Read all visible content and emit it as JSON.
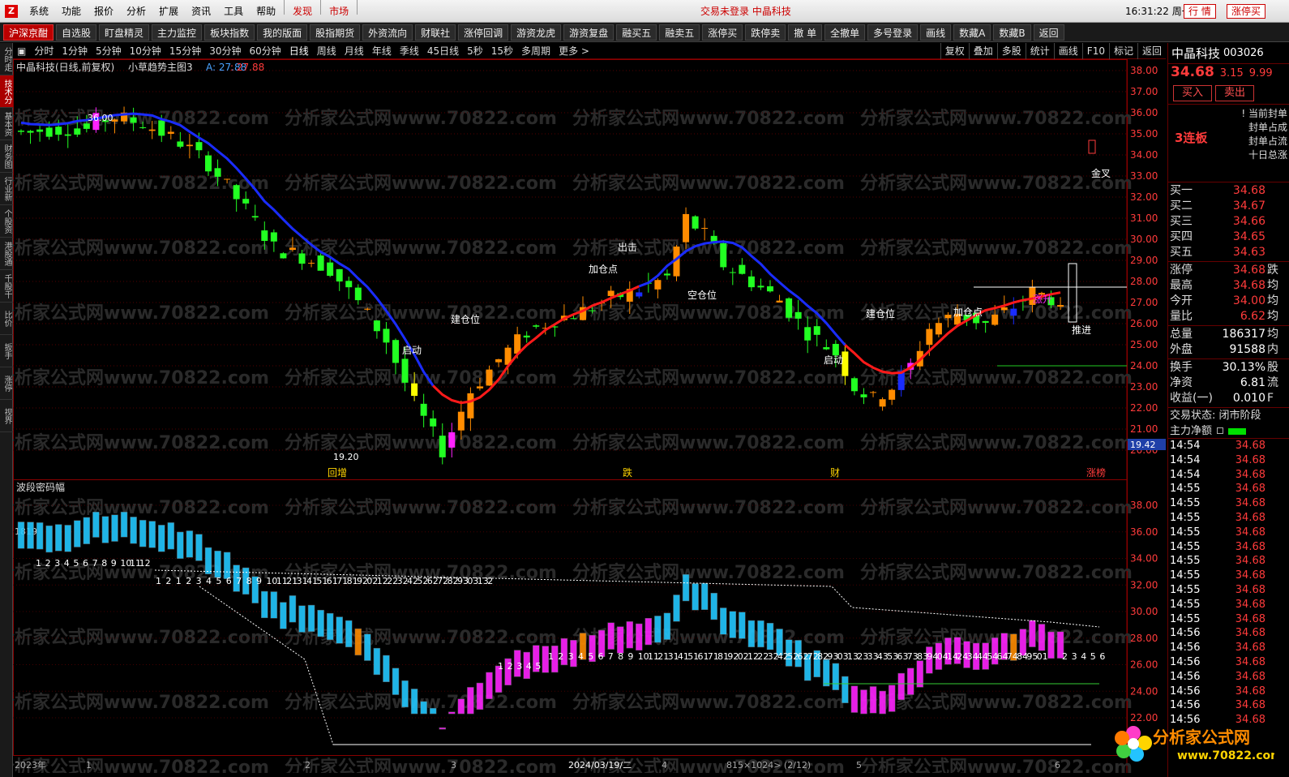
{
  "menu": {
    "items": [
      "系统",
      "功能",
      "报价",
      "分析",
      "扩展",
      "资讯",
      "工具",
      "帮助"
    ],
    "red_items": [
      "发现",
      "市场"
    ],
    "status_text": "交易未登录  中晶科技",
    "clock": "16:31:22 周一",
    "btn_quote": "行 情",
    "btn_limitup": "涨停买"
  },
  "toolbar": {
    "items": [
      "沪深京酣",
      "自选股",
      "盯盘精灵",
      "主力监控",
      "板块指数",
      "我的版面",
      "股指期货",
      "外资流向",
      "财联社",
      "涨停回调",
      "游资龙虎",
      "游资复盘",
      "融买五",
      "融卖五",
      "涨停买",
      "跌停卖",
      "撤 单",
      "全撤单",
      "多号登录",
      "画线",
      "数藏A",
      "数藏B",
      "返回"
    ]
  },
  "periods": {
    "left": [
      "分时",
      "1分钟",
      "5分钟",
      "10分钟",
      "15分钟",
      "30分钟",
      "60分钟",
      "日线",
      "周线",
      "月线",
      "年线",
      "季线",
      "45日线",
      "5秒",
      "15秒",
      "多周期",
      "更多 >"
    ],
    "right": [
      "复权",
      "叠加",
      "多股",
      "统计",
      "画线",
      "F10",
      "标记",
      "返回"
    ]
  },
  "left_tabs": [
    "分时走势",
    "技术分析",
    "基本资料",
    "财务图示",
    "行业新闻",
    "个股资讯",
    "港股通",
    "千股千评",
    "比价",
    "扳手",
    "涨停",
    "视界"
  ],
  "main_chart": {
    "title": "中晶科技(日线,前复权)",
    "indicator": "小草趋势主图3",
    "indicator_a_label": "A: 27.88",
    "indicator_b_label": ": 27.88",
    "y_ticks": [
      "38.00",
      "37.00",
      "36.00",
      "35.00",
      "34.00",
      "33.00",
      "32.00",
      "31.00",
      "30.00",
      "29.00",
      "28.00",
      "27.00",
      "26.00",
      "25.00",
      "24.00",
      "23.00",
      "22.00",
      "21.00",
      "20.00"
    ],
    "y_min": 20,
    "y_max": 38,
    "current_price_tag": "19.42",
    "high_label": "36.00",
    "low_label": "19.20",
    "labels": [
      "启动",
      "建仓位",
      "加仓点",
      "出击",
      "空仓位",
      "启动",
      "建仓位",
      "加仓点",
      "涨升",
      "推进",
      "金叉"
    ],
    "bottom_tags": [
      "回增",
      "跌",
      "财",
      "涨榜"
    ]
  },
  "sub_chart": {
    "title": "波段密码幅",
    "y_ticks": [
      "38.00",
      "36.00",
      "34.00",
      "32.00",
      "30.00",
      "28.00",
      "26.00",
      "24.00",
      "22.00"
    ],
    "left_label": "1819",
    "count_row1": [
      "1",
      "2",
      "3",
      "4",
      "5",
      "6",
      "7",
      "8",
      "9",
      "10",
      "11",
      "12"
    ],
    "count_row2": [
      "1",
      "2",
      "1",
      "2",
      "3",
      "4",
      "5",
      "6",
      "7",
      "8",
      "9",
      "10",
      "11",
      "21",
      "31",
      "41",
      "51",
      "61",
      "71",
      "81",
      "92",
      "02",
      "12",
      "22",
      "32",
      "42",
      "52",
      "62",
      "72",
      "82",
      "93",
      "03",
      "13",
      "2"
    ],
    "count_row3": [
      "1",
      "2",
      "3",
      "4",
      "5"
    ],
    "count_row4": [
      "1",
      "2",
      "3",
      "4",
      "5",
      "6",
      "7",
      "8",
      "9",
      "10",
      "11",
      "21",
      "31",
      "41",
      "51",
      "61",
      "71",
      "81",
      "92",
      "02",
      "12",
      "22",
      "32",
      "42",
      "52",
      "62",
      "72",
      "82",
      "93",
      "03",
      "13",
      "23",
      "33",
      "43",
      "53",
      "63",
      "73",
      "83",
      "94",
      "04",
      "14",
      "24",
      "34",
      "44",
      "54",
      "64",
      "74",
      "84",
      "95",
      "01"
    ],
    "count_row5": [
      "2",
      "3",
      "4",
      "5",
      "6"
    ]
  },
  "x_axis": {
    "labels": [
      "2023年",
      "1",
      "2",
      "3",
      "2024/03/19/二",
      "4",
      "815×1024> (2/12)",
      "5",
      "6"
    ]
  },
  "right_panel": {
    "name": "中晶科技",
    "code": "003026",
    "price": "34.68",
    "change": "3.15",
    "pct": "9.99",
    "buy": "买入",
    "sell": "卖出",
    "streak": "3连板",
    "seal_lines": [
      "! 当前封单",
      "封单占成",
      "封单占流",
      "十日总涨"
    ],
    "bids": [
      {
        "k": "买一",
        "v": "34.68"
      },
      {
        "k": "买二",
        "v": "34.67"
      },
      {
        "k": "买三",
        "v": "34.66"
      },
      {
        "k": "买四",
        "v": "34.65"
      },
      {
        "k": "买五",
        "v": "34.63"
      }
    ],
    "stats1": [
      {
        "k": "涨停",
        "v": "34.68",
        "x": "跌"
      },
      {
        "k": "最高",
        "v": "34.68",
        "x": "均"
      },
      {
        "k": "今开",
        "v": "34.00",
        "x": "均"
      },
      {
        "k": "量比",
        "v": "6.62",
        "x": "均"
      }
    ],
    "stats2": [
      {
        "k": "总量",
        "v": "186317",
        "x": "均"
      },
      {
        "k": "外盘",
        "v": "91588",
        "x": "内"
      }
    ],
    "stats3": [
      {
        "k": "换手",
        "v": "30.13%",
        "x": "股"
      },
      {
        "k": "净资",
        "v": "6.81",
        "x": "流"
      },
      {
        "k": "收益(一)",
        "v": "0.010",
        "x": "F"
      }
    ],
    "trade_status": "交易状态: 闭市阶段",
    "main_net": "主力净额",
    "ticks": [
      {
        "t": "14:54",
        "p": "34.68"
      },
      {
        "t": "14:54",
        "p": "34.68"
      },
      {
        "t": "14:54",
        "p": "34.68"
      },
      {
        "t": "14:55",
        "p": "34.68"
      },
      {
        "t": "14:55",
        "p": "34.68"
      },
      {
        "t": "14:55",
        "p": "34.68"
      },
      {
        "t": "14:55",
        "p": "34.68"
      },
      {
        "t": "14:55",
        "p": "34.68"
      },
      {
        "t": "14:55",
        "p": "34.68"
      },
      {
        "t": "14:55",
        "p": "34.68"
      },
      {
        "t": "14:55",
        "p": "34.68"
      },
      {
        "t": "14:55",
        "p": "34.68"
      },
      {
        "t": "14:55",
        "p": "34.68"
      },
      {
        "t": "14:56",
        "p": "34.68"
      },
      {
        "t": "14:56",
        "p": "34.68"
      },
      {
        "t": "14:56",
        "p": "34.68"
      },
      {
        "t": "14:56",
        "p": "34.68"
      },
      {
        "t": "14:56",
        "p": "34.68"
      },
      {
        "t": "14:56",
        "p": "34.68"
      },
      {
        "t": "14:56",
        "p": "34.68"
      }
    ]
  },
  "watermark": "分析家公式网www.70822.com",
  "logo_text": "分析家公式网",
  "logo_url": "www.70822.com",
  "colors": {
    "up": "#ff3b3b",
    "down": "#00e000",
    "ma_blue": "#1a2cff",
    "ma_red": "#ff1a1a",
    "cyan": "#22c8ff",
    "magenta": "#ff22ff",
    "orange": "#ff8c00",
    "yellow": "#ffff00"
  }
}
